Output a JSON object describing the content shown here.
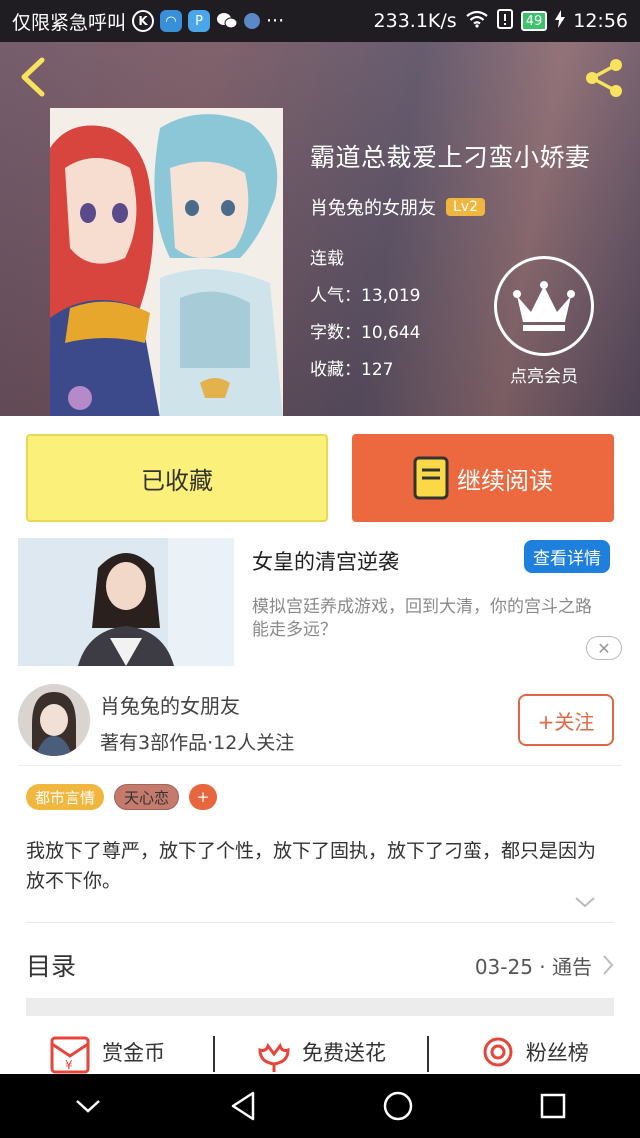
{
  "status_bar": {
    "left_text": "仅限紧急呼叫",
    "net_speed": "233.1K/s",
    "battery": "49",
    "time": "12:56",
    "more": "···"
  },
  "book": {
    "title": "霸道总裁爱上刁蛮小娇妻",
    "author": "肖兔兔的女朋友",
    "level": "Lv2",
    "status": "连载",
    "popularity": "人气：13,019",
    "word_count": "字数：10,644",
    "favorites": "收藏：127"
  },
  "vip": {
    "label": "点亮会员"
  },
  "actions": {
    "collected_label": "已收藏",
    "continue_label": "继续阅读"
  },
  "ad": {
    "title": "女皇的清宫逆袭",
    "detail_label": "查看详情",
    "description": "模拟宫廷养成游戏，回到大清，你的宫斗之路能走多远？",
    "close": "✕"
  },
  "author_card": {
    "name": "肖兔兔的女朋友",
    "meta": "著有3部作品·12人关注",
    "follow_label": "+关注"
  },
  "tags": [
    "都市言情",
    "天心恋",
    "+"
  ],
  "summary": "我放下了尊严，放下了个性，放下了固执，放下了刁蛮，都只是因为放不下你。",
  "toc": {
    "label": "目录",
    "latest": "03-25 · 通告"
  },
  "bottom_actions": [
    "赏金币",
    "免费送花",
    "粉丝榜"
  ],
  "colors": {
    "accent_orange": "#ec693f",
    "collected_yellow": "#fbf07a",
    "badge_gold": "#f0b63d",
    "ad_blue": "#1e7fdc"
  }
}
